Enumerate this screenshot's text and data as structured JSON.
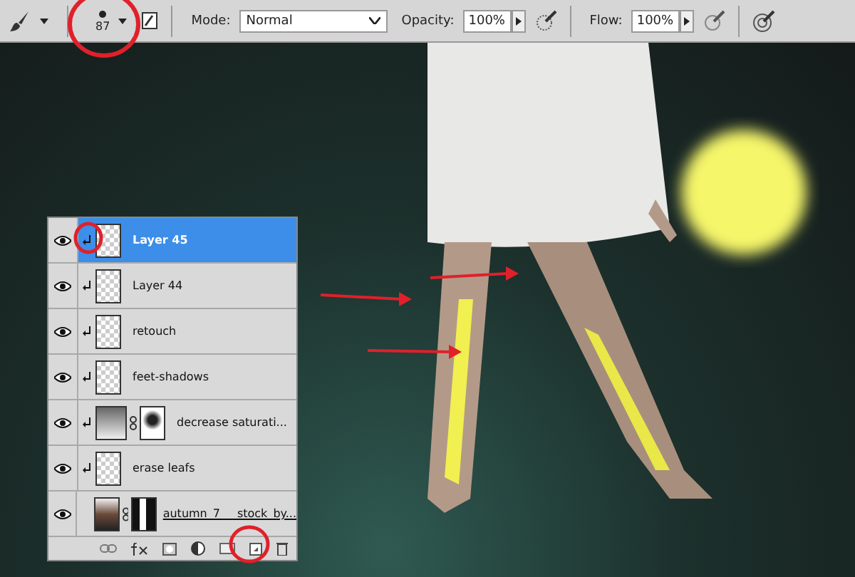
{
  "toolbar": {
    "brush_size": "87",
    "mode_label": "Mode:",
    "mode_value": "Normal",
    "opacity_label": "Opacity:",
    "opacity_value": "100%",
    "flow_label": "Flow:",
    "flow_value": "100%"
  },
  "layers": [
    {
      "name": "Layer 45",
      "kind": "plain",
      "selected": true,
      "clipped": true
    },
    {
      "name": "Layer 44",
      "kind": "plain",
      "selected": false,
      "clipped": true
    },
    {
      "name": "retouch",
      "kind": "plain",
      "selected": false,
      "clipped": true
    },
    {
      "name": "feet-shadows",
      "kind": "plain",
      "selected": false,
      "clipped": true
    },
    {
      "name": "decrease saturati...",
      "kind": "adjustment",
      "selected": false,
      "clipped": true
    },
    {
      "name": "erase leafs",
      "kind": "plain",
      "selected": false,
      "clipped": true
    },
    {
      "name": "autumn_7___stock_by...",
      "kind": "smart",
      "selected": false,
      "clipped": false
    }
  ]
}
